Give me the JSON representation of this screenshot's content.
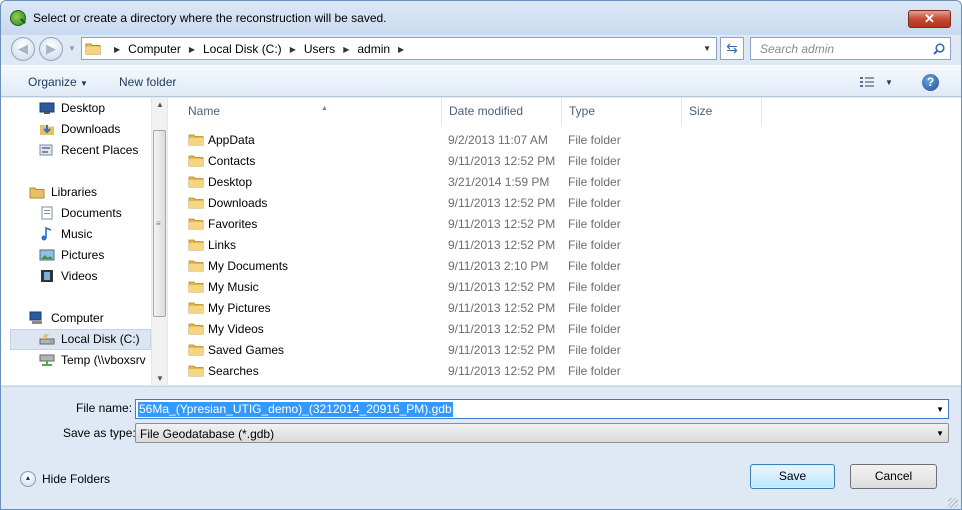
{
  "window": {
    "title": "Select or create a directory where the reconstruction will be saved.",
    "close_label": "✕"
  },
  "address": {
    "crumbs": [
      "Computer",
      "Local Disk (C:)",
      "Users",
      "admin"
    ]
  },
  "search": {
    "placeholder": "Search admin"
  },
  "toolbar": {
    "organize_label": "Organize",
    "new_folder_label": "New folder"
  },
  "sidebar": {
    "favorites": [
      {
        "label": "Desktop",
        "icon": "desktop-icon"
      },
      {
        "label": "Downloads",
        "icon": "downloads-icon"
      },
      {
        "label": "Recent Places",
        "icon": "recent-places-icon"
      }
    ],
    "libraries_label": "Libraries",
    "libraries": [
      {
        "label": "Documents",
        "icon": "documents-icon"
      },
      {
        "label": "Music",
        "icon": "music-icon"
      },
      {
        "label": "Pictures",
        "icon": "pictures-icon"
      },
      {
        "label": "Videos",
        "icon": "videos-icon"
      }
    ],
    "computer_label": "Computer",
    "computer": [
      {
        "label": "Local Disk (C:)",
        "icon": "local-disk-icon",
        "selected": true
      },
      {
        "label": "Temp (\\\\vboxsrv",
        "icon": "network-drive-icon"
      }
    ]
  },
  "columns": {
    "name": "Name",
    "date": "Date modified",
    "type": "Type",
    "size": "Size"
  },
  "files": [
    {
      "name": "AppData",
      "date": "9/2/2013 11:07 AM",
      "type": "File folder",
      "icon": "folder-icon"
    },
    {
      "name": "Contacts",
      "date": "9/11/2013 12:52 PM",
      "type": "File folder",
      "icon": "contacts-folder-icon"
    },
    {
      "name": "Desktop",
      "date": "3/21/2014 1:59 PM",
      "type": "File folder",
      "icon": "desktop-folder-icon"
    },
    {
      "name": "Downloads",
      "date": "9/11/2013 12:52 PM",
      "type": "File folder",
      "icon": "downloads-folder-icon"
    },
    {
      "name": "Favorites",
      "date": "9/11/2013 12:52 PM",
      "type": "File folder",
      "icon": "favorites-folder-icon"
    },
    {
      "name": "Links",
      "date": "9/11/2013 12:52 PM",
      "type": "File folder",
      "icon": "links-folder-icon"
    },
    {
      "name": "My Documents",
      "date": "9/11/2013 2:10 PM",
      "type": "File folder",
      "icon": "documents-folder-icon"
    },
    {
      "name": "My Music",
      "date": "9/11/2013 12:52 PM",
      "type": "File folder",
      "icon": "music-folder-icon"
    },
    {
      "name": "My Pictures",
      "date": "9/11/2013 12:52 PM",
      "type": "File folder",
      "icon": "pictures-folder-icon"
    },
    {
      "name": "My Videos",
      "date": "9/11/2013 12:52 PM",
      "type": "File folder",
      "icon": "videos-folder-icon"
    },
    {
      "name": "Saved Games",
      "date": "9/11/2013 12:52 PM",
      "type": "File folder",
      "icon": "saved-games-folder-icon"
    },
    {
      "name": "Searches",
      "date": "9/11/2013 12:52 PM",
      "type": "File folder",
      "icon": "searches-folder-icon"
    }
  ],
  "form": {
    "file_name_label": "File name:",
    "file_name_value": "56Ma_(Ypresian_UTIG_demo)_(3212014_20916_PM).gdb",
    "save_type_label": "Save as type:",
    "save_type_value": "File Geodatabase (*.gdb)"
  },
  "footer": {
    "hide_folders_label": "Hide Folders",
    "save_label": "Save",
    "cancel_label": "Cancel"
  },
  "colors": {
    "selection": "#3399ff",
    "accent": "#3c7fb1",
    "close": "#c54b34"
  }
}
